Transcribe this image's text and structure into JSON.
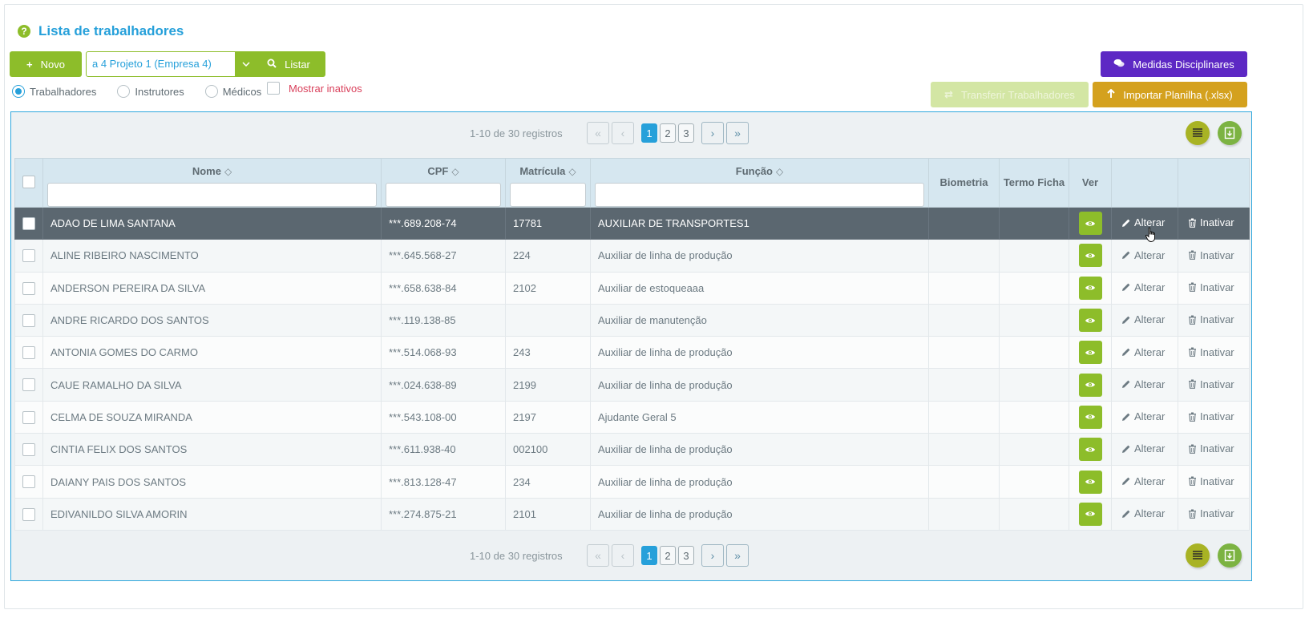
{
  "header": {
    "title": "Lista de trabalhadores"
  },
  "toolbar": {
    "novo_label": "Novo",
    "company_value": "a 4 Projeto 1 (Empresa 4)",
    "listar_label": "Listar",
    "medidas_label": "Medidas Disciplinares",
    "transferir_label": "Transferir Trabalhadores",
    "importar_label": "Importar Planilha (.xlsx)"
  },
  "filters": {
    "radios": [
      "Trabalhadores",
      "Instrutores",
      "Médicos"
    ],
    "selected_radio": "Trabalhadores",
    "mostrar_inativos": "Mostrar inativos"
  },
  "pagination": {
    "info": "1-10 de 30 registros",
    "pages": [
      "1",
      "2",
      "3"
    ],
    "current": "1"
  },
  "columns": {
    "nome": "Nome",
    "cpf": "CPF",
    "matricula": "Matrícula",
    "funcao": "Função",
    "biometria": "Biometria",
    "termo_ficha": "Termo Ficha",
    "ver": "Ver"
  },
  "actions": {
    "alterar": "Alterar",
    "inativar": "Inativar"
  },
  "rows": [
    {
      "nome": "ADAO DE LIMA SANTANA",
      "cpf": "***.689.208-74",
      "matricula": "17781",
      "funcao": "AUXILIAR DE TRANSPORTES1"
    },
    {
      "nome": "ALINE RIBEIRO NASCIMENTO",
      "cpf": "***.645.568-27",
      "matricula": "224",
      "funcao": "Auxiliar de linha de produção"
    },
    {
      "nome": "ANDERSON PEREIRA DA SILVA",
      "cpf": "***.658.638-84",
      "matricula": "2102",
      "funcao": "Auxiliar de estoqueaaa"
    },
    {
      "nome": "ANDRE RICARDO DOS SANTOS",
      "cpf": "***.119.138-85",
      "matricula": "",
      "funcao": "Auxiliar de manutenção"
    },
    {
      "nome": "ANTONIA GOMES DO CARMO",
      "cpf": "***.514.068-93",
      "matricula": "243",
      "funcao": "Auxiliar de linha de produção"
    },
    {
      "nome": "CAUE RAMALHO DA SILVA",
      "cpf": "***.024.638-89",
      "matricula": "2199",
      "funcao": "Auxiliar de linha de produção"
    },
    {
      "nome": "CELMA DE SOUZA MIRANDA",
      "cpf": "***.543.108-00",
      "matricula": "2197",
      "funcao": "Ajudante Geral 5"
    },
    {
      "nome": "CINTIA FELIX DOS SANTOS",
      "cpf": "***.611.938-40",
      "matricula": "002100",
      "funcao": "Auxiliar de linha de produção"
    },
    {
      "nome": "DAIANY PAIS DOS SANTOS",
      "cpf": "***.813.128-47",
      "matricula": "234",
      "funcao": "Auxiliar de linha de produção"
    },
    {
      "nome": "EDIVANILDO SILVA AMORIN",
      "cpf": "***.274.875-21",
      "matricula": "2101",
      "funcao": "Auxiliar de linha de produção"
    }
  ],
  "colors": {
    "primary_green": "#8dbd2a",
    "title_blue": "#26a0da",
    "purple": "#5d28c4",
    "gold": "#d4a11e",
    "selected_row": "#5b6770",
    "alert_red": "#d93f5a"
  }
}
